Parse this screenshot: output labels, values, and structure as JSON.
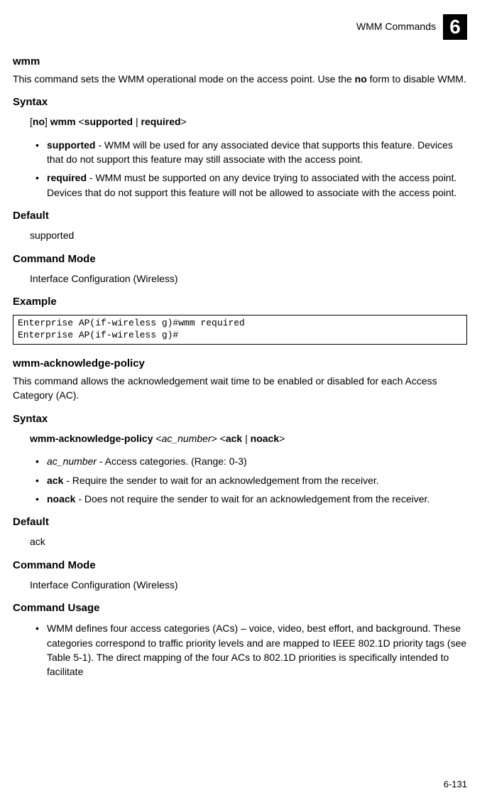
{
  "header": {
    "title": "WMM Commands",
    "chapter": "6"
  },
  "wmm": {
    "title": "wmm",
    "desc1": "This command sets the WMM operational mode on the access point. Use the ",
    "desc_no": "no",
    "desc2": " form to disable WMM.",
    "syntax_label": "Syntax",
    "syntax_line_pre": "[",
    "syntax_no": "no",
    "syntax_mid1": "] ",
    "syntax_wmm": "wmm",
    "syntax_mid2": " <",
    "syntax_sup": "supported",
    "syntax_pipe": " | ",
    "syntax_req": "required",
    "syntax_end": ">",
    "bullet1_bold": "supported",
    "bullet1_text": " - WMM will be used for any associated device that supports this feature. Devices that do not support this feature may still associate with the access point.",
    "bullet2_bold": "required",
    "bullet2_text": " - WMM must be supported on any device trying to associated with the access point. Devices that do not support this feature will not be allowed to associate with the access point.",
    "default_label": "Default",
    "default_val": "supported",
    "cmdmode_label": "Command Mode",
    "cmdmode_val": "Interface Configuration (Wireless)",
    "example_label": "Example",
    "example_code": "Enterprise AP(if-wireless g)#wmm required\nEnterprise AP(if-wireless g)#"
  },
  "ack": {
    "title": "wmm-acknowledge-policy",
    "desc": "This command allows the acknowledgement wait time to be enabled or disabled for each Access Category (AC).",
    "syntax_label": "Syntax",
    "syntax_cmd": "wmm-acknowledge-policy",
    "syntax_mid1": " <",
    "syntax_ac": "ac_number",
    "syntax_mid2": "> <",
    "syntax_ack": "ack",
    "syntax_pipe": " | ",
    "syntax_noack": "noack",
    "syntax_end": ">",
    "b1_italic": "ac_number",
    "b1_text": " - Access categories. (Range: 0-3)",
    "b2_bold": "ack",
    "b2_text": " - Require the sender to wait for an acknowledgement from the receiver.",
    "b3_bold": "noack",
    "b3_text": " - Does not require the sender to wait for an acknowledgement from the receiver.",
    "default_label": "Default",
    "default_val": "ack",
    "cmdmode_label": "Command Mode",
    "cmdmode_val": "Interface Configuration (Wireless)",
    "usage_label": "Command Usage",
    "usage_text": "WMM defines four access categories (ACs) – voice, video, best effort, and background. These categories correspond to traffic priority levels and are mapped to IEEE 802.1D priority tags (see Table 5-1). The direct mapping of the four ACs to 802.1D priorities is specifically intended to facilitate"
  },
  "page_num": "6-131"
}
